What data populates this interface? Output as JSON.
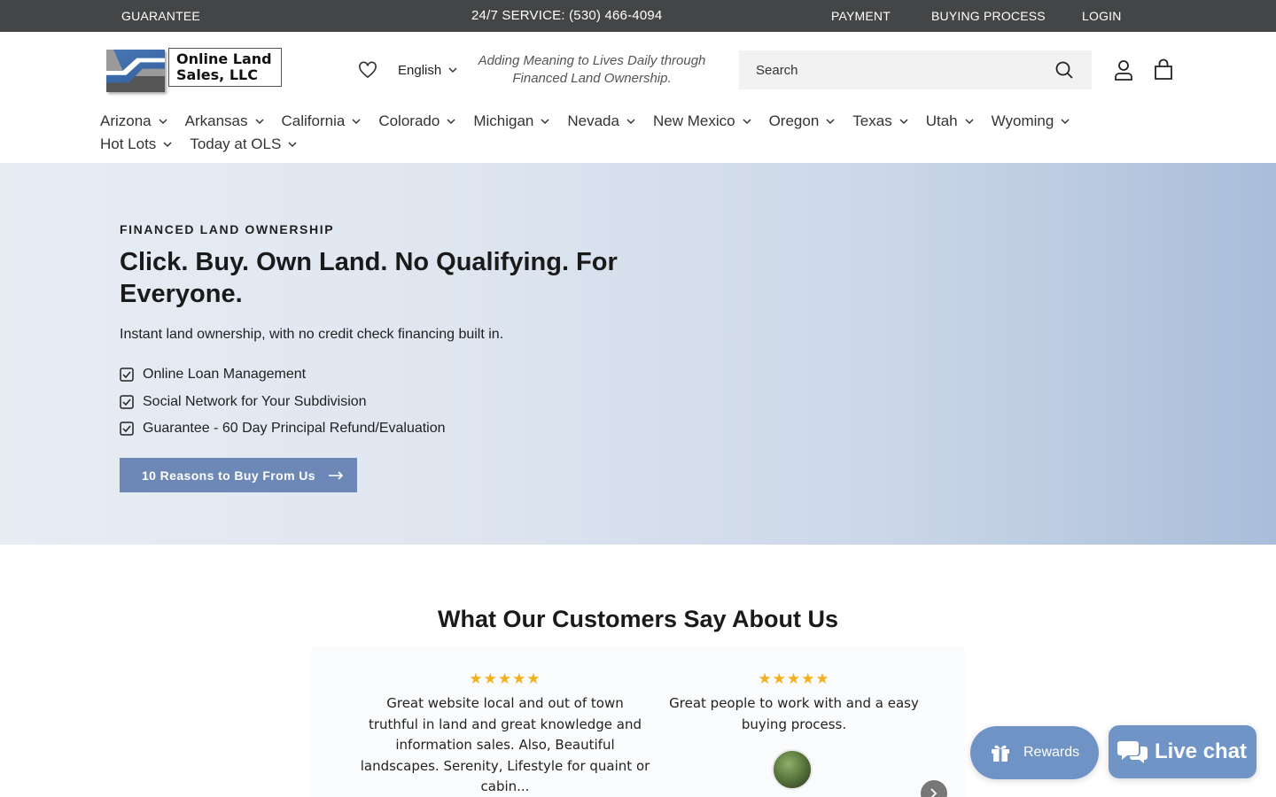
{
  "topbar": {
    "guarantee": "GUARANTEE",
    "service": "24/7 SERVICE: (530) 466-4094",
    "payment": "PAYMENT",
    "buying_process": "BUYING PROCESS",
    "login": "LOGIN"
  },
  "header": {
    "logo_line1": "Online Land",
    "logo_line2": "Sales, LLC",
    "language": "English",
    "tagline": "Adding Meaning to Lives Daily through Financed Land Ownership.",
    "search_placeholder": "Search"
  },
  "nav": {
    "row1": [
      "Arizona",
      "Arkansas",
      "California",
      "Colorado",
      "Michigan",
      "Nevada",
      "New Mexico",
      "Oregon",
      "Texas",
      "Utah",
      "Wyoming"
    ],
    "row2": [
      "Hot Lots",
      "Today at OLS"
    ]
  },
  "hero": {
    "eyebrow": "FINANCED LAND OWNERSHIP",
    "title": "Click. Buy. Own Land. No Qualifying. For Everyone.",
    "subtitle": "Instant land ownership, with no credit check financing built in.",
    "features": [
      "Online Loan Management",
      "Social Network for Your Subdivision",
      "Guarantee - 60 Day Principal Refund/Evaluation"
    ],
    "cta_label": "10 Reasons to Buy From Us"
  },
  "testimonials": {
    "title": "What Our Customers Say About Us",
    "reviews": [
      {
        "stars": "★★★★★",
        "text": "Great website local and out of town truthful in land and great knowledge and information sales. Also, Beautiful landscapes. Serenity, Lifestyle for quaint or cabin..."
      },
      {
        "stars": "★★★★★",
        "text": "Great people to work with and a easy buying process."
      }
    ]
  },
  "widgets": {
    "rewards_label": "Rewards",
    "livechat_label": "Live chat"
  },
  "colors": {
    "topbar_bg": "#444546",
    "accent": "#6d88b6",
    "widget_blue": "#7093c6",
    "star": "#f2b01e"
  }
}
